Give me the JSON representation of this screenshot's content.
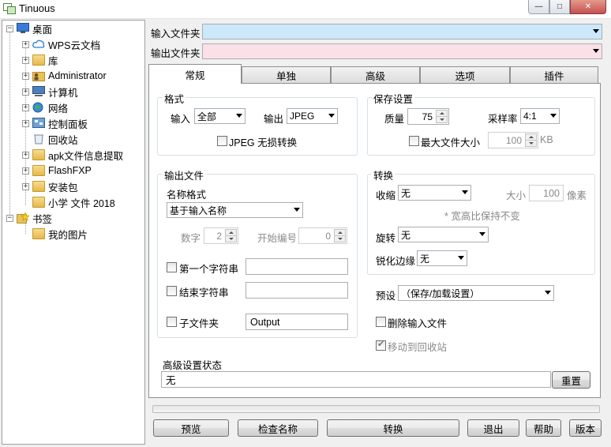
{
  "window": {
    "title": "Tinuous",
    "min": "—",
    "max": "□",
    "close": "✕"
  },
  "tree": {
    "items": [
      {
        "label": "桌面",
        "expander": "−"
      },
      {
        "label": "WPS云文档",
        "expander": "+"
      },
      {
        "label": "库",
        "expander": "+"
      },
      {
        "label": "Administrator",
        "expander": "+"
      },
      {
        "label": "计算机",
        "expander": "+"
      },
      {
        "label": "网络",
        "expander": "+"
      },
      {
        "label": "控制面板",
        "expander": "+"
      },
      {
        "label": "回收站",
        "expander": ""
      },
      {
        "label": "apk文件信息提取",
        "expander": "+"
      },
      {
        "label": "FlashFXP",
        "expander": "+"
      },
      {
        "label": "安装包",
        "expander": "+"
      },
      {
        "label": "小学 文件 2018",
        "expander": ""
      },
      {
        "label": "书签",
        "expander": "−"
      },
      {
        "label": "我的图片",
        "expander": ""
      }
    ]
  },
  "paths": {
    "input_label": "输入文件夹",
    "input_value": "",
    "output_label": "输出文件夹",
    "output_value": "",
    "input_color": "#cce8fb",
    "output_color": "#fbe0e8"
  },
  "tabs": [
    {
      "label": "常规",
      "active": true
    },
    {
      "label": "单独"
    },
    {
      "label": "高级"
    },
    {
      "label": "选项"
    },
    {
      "label": "插件"
    }
  ],
  "format": {
    "group": "格式",
    "input_label": "输入",
    "input_value": "全部",
    "output_label": "输出",
    "output_value": "JPEG",
    "lossless_label": "JPEG 无损转换"
  },
  "save": {
    "group": "保存设置",
    "quality_label": "质量",
    "quality_value": "75",
    "sampling_label": "采样率",
    "sampling_value": "4:1",
    "maxsize_label": "最大文件大小",
    "maxsize_value": "100",
    "maxsize_unit": "KB"
  },
  "output_file": {
    "group": "输出文件",
    "name_format_label": "名称格式",
    "name_format_value": "基于输入名称",
    "digits_label": "数字",
    "digits_value": "2",
    "start_label": "开始编号",
    "start_value": "0",
    "first_string_label": "第一个字符串",
    "first_string_value": "",
    "end_string_label": "结束字符串",
    "end_string_value": "",
    "subfolder_label": "子文件夹",
    "subfolder_value": "Output"
  },
  "convert": {
    "group": "转换",
    "shrink_label": "收缩",
    "shrink_value": "无",
    "size_label": "大小",
    "size_value": "100",
    "size_unit": "像素",
    "aspect_note": "* 宽高比保持不变",
    "rotate_label": "旋转",
    "rotate_value": "无",
    "sharpen_label": "锐化边缘",
    "sharpen_value": "无"
  },
  "preset": {
    "label": "预设",
    "value": "（保存/加载设置）"
  },
  "delete_input_label": "删除输入文件",
  "move_recycle_label": "移动到回收站",
  "advanced_status": {
    "label": "高级设置状态",
    "value": "无",
    "reset": "重置"
  },
  "bottom_buttons": {
    "preview": "预览",
    "check_names": "检查名称",
    "convert": "转换",
    "exit": "退出",
    "help": "帮助",
    "version": "版本"
  }
}
